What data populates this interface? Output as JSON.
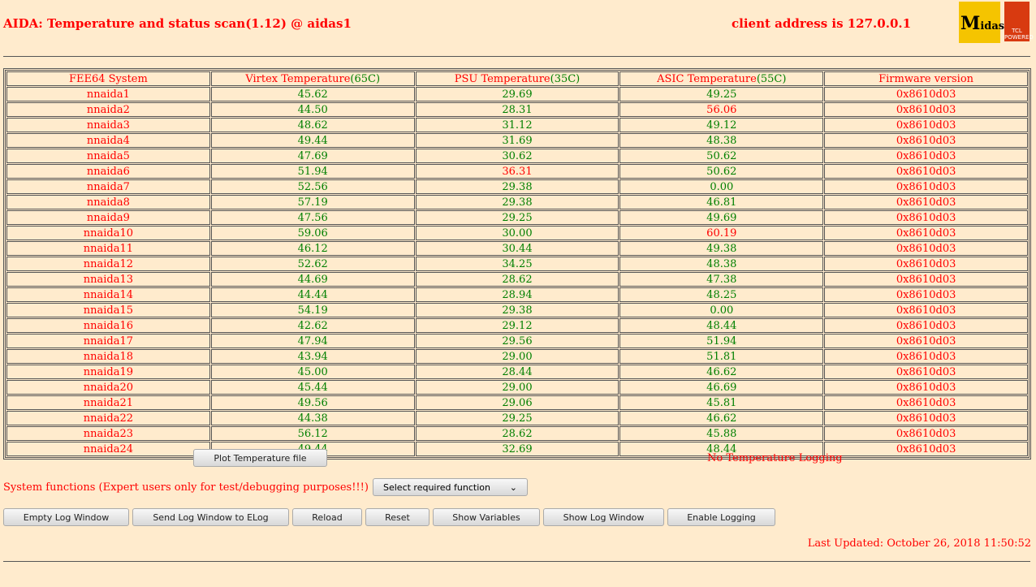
{
  "header": {
    "title": "AIDA: Temperature and status scan(1.12) @ aidas1",
    "client": "client address is 127.0.0.1",
    "logo_midas": "Midas",
    "logo_tcl": "TCL POWERED"
  },
  "table": {
    "headers": [
      {
        "text": "FEE64 System"
      },
      {
        "text": "Virtex Temperature",
        "limit": "(65C)"
      },
      {
        "text": "PSU Temperature",
        "limit": "(35C)"
      },
      {
        "text": "ASIC Temperature",
        "limit": "(55C)"
      },
      {
        "text": "Firmware version"
      }
    ],
    "rows": [
      [
        "nnaida1",
        "45.62",
        "29.69",
        "49.25",
        "0x8610d03"
      ],
      [
        "nnaida2",
        "44.50",
        "28.31",
        "56.06",
        "0x8610d03"
      ],
      [
        "nnaida3",
        "48.62",
        "31.12",
        "49.12",
        "0x8610d03"
      ],
      [
        "nnaida4",
        "49.44",
        "31.69",
        "48.38",
        "0x8610d03"
      ],
      [
        "nnaida5",
        "47.69",
        "30.62",
        "50.62",
        "0x8610d03"
      ],
      [
        "nnaida6",
        "51.94",
        "36.31",
        "50.62",
        "0x8610d03"
      ],
      [
        "nnaida7",
        "52.56",
        "29.38",
        "0.00",
        "0x8610d03"
      ],
      [
        "nnaida8",
        "57.19",
        "29.38",
        "46.81",
        "0x8610d03"
      ],
      [
        "nnaida9",
        "47.56",
        "29.25",
        "49.69",
        "0x8610d03"
      ],
      [
        "nnaida10",
        "59.06",
        "30.00",
        "60.19",
        "0x8610d03"
      ],
      [
        "nnaida11",
        "46.12",
        "30.44",
        "49.38",
        "0x8610d03"
      ],
      [
        "nnaida12",
        "52.62",
        "34.25",
        "48.38",
        "0x8610d03"
      ],
      [
        "nnaida13",
        "44.69",
        "28.62",
        "47.38",
        "0x8610d03"
      ],
      [
        "nnaida14",
        "44.44",
        "28.94",
        "48.25",
        "0x8610d03"
      ],
      [
        "nnaida15",
        "54.19",
        "29.38",
        "0.00",
        "0x8610d03"
      ],
      [
        "nnaida16",
        "42.62",
        "29.12",
        "48.44",
        "0x8610d03"
      ],
      [
        "nnaida17",
        "47.94",
        "29.56",
        "51.94",
        "0x8610d03"
      ],
      [
        "nnaida18",
        "43.94",
        "29.00",
        "51.81",
        "0x8610d03"
      ],
      [
        "nnaida19",
        "45.00",
        "28.44",
        "46.62",
        "0x8610d03"
      ],
      [
        "nnaida20",
        "45.44",
        "29.00",
        "46.69",
        "0x8610d03"
      ],
      [
        "nnaida21",
        "49.56",
        "29.06",
        "45.81",
        "0x8610d03"
      ],
      [
        "nnaida22",
        "44.38",
        "29.25",
        "46.62",
        "0x8610d03"
      ],
      [
        "nnaida23",
        "56.12",
        "28.62",
        "45.88",
        "0x8610d03"
      ],
      [
        "nnaida24",
        "49.44",
        "32.69",
        "48.44",
        "0x8610d03"
      ]
    ],
    "limits": [
      65,
      35,
      55
    ]
  },
  "plot_button": "Plot Temperature file",
  "logging_status": "No Temperature Logging",
  "system_functions_label": "System functions (Expert users only for test/debugging purposes!!!)",
  "select_function": "Select required function",
  "buttons": [
    "Empty Log Window",
    "Send Log Window to ELog",
    "Reload",
    "Reset",
    "Show Variables",
    "Show Log Window",
    "Enable Logging"
  ],
  "last_updated": "Last Updated: October 26, 2018 11:50:52"
}
